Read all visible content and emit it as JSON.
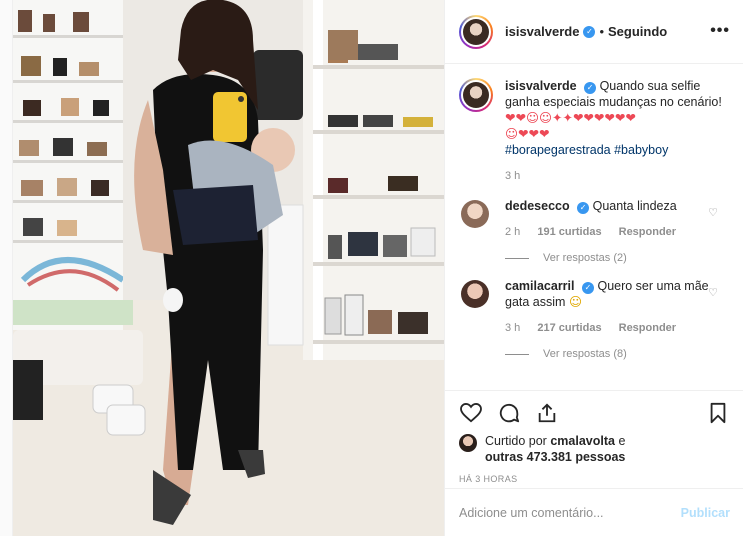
{
  "header": {
    "username": "isisvalverde",
    "separator": "•",
    "follow_status": "Seguindo",
    "more": "•••"
  },
  "caption": {
    "username": "isisvalverde",
    "text": "Quando sua selfie ganha especiais mudanças no cenário!",
    "emoji_line1": "❤❤☺☺✦✦❤❤❤❤❤❤",
    "emoji_line2": "☺❤❤❤",
    "hashtags": "#borapegarestrada #babyboy",
    "time": "3 h"
  },
  "comments": [
    {
      "username": "dedesecco",
      "text": "Quanta lindeza",
      "time": "2 h",
      "likes": "191 curtidas",
      "reply": "Responder",
      "replies": "Ver respostas (2)",
      "avatar_color": "#d9b8a2"
    },
    {
      "username": "camilacarril",
      "text": "Quero ser uma mãe gata assim",
      "emoji": "☺",
      "time": "3 h",
      "likes": "217 curtidas",
      "reply": "Responder",
      "replies": "Ver respostas (8)",
      "avatar_color": "#c9a08e"
    }
  ],
  "actions": {
    "liked_by_prefix": "Curtido por",
    "liked_by_user": "cmalavolta",
    "liked_by_and": "e",
    "liked_by_others": "outras 473.381 pessoas",
    "time_ago": "HÁ 3 HORAS"
  },
  "add_comment": {
    "placeholder": "Adicione um comentário...",
    "publish": "Publicar"
  },
  "icons": [
    "heart-icon",
    "comment-icon",
    "share-icon",
    "bookmark-icon",
    "verified-badge-icon",
    "more-options-icon"
  ],
  "colors": {
    "verified": "#3897f0",
    "hashtag": "#003569",
    "publish_disabled": "#b2dffc",
    "meta": "#8e8e8e"
  }
}
